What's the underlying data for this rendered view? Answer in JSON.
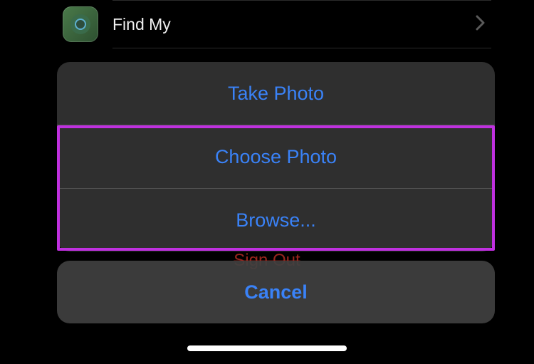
{
  "settings": {
    "findmy": {
      "label": "Find My"
    }
  },
  "background": {
    "signout_label": "Sign Out"
  },
  "actionsheet": {
    "options": {
      "take_photo": "Take Photo",
      "choose_photo": "Choose Photo",
      "browse": "Browse..."
    },
    "cancel": "Cancel"
  }
}
